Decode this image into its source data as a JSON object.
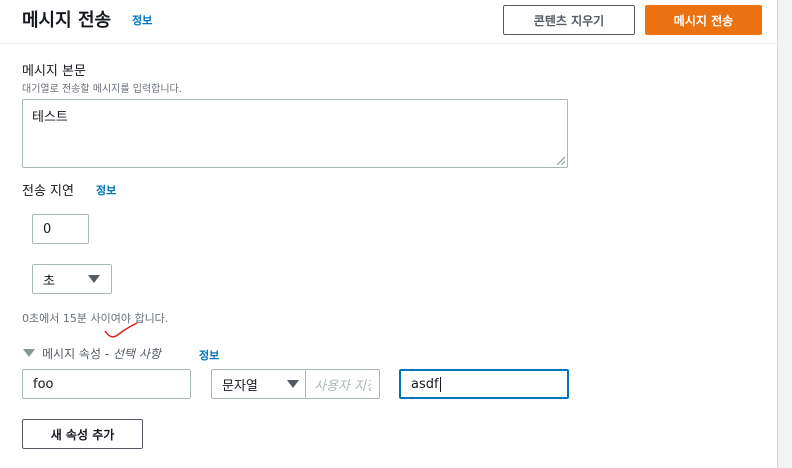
{
  "header": {
    "title": "메시지 전송",
    "info": "정보",
    "clear_button": "콘텐츠 지우기",
    "send_button": "메시지 전송"
  },
  "body_field": {
    "label": "메시지 본문",
    "description": "대기열로 전송할 메시지를 입력합니다.",
    "value": "테스트"
  },
  "delay": {
    "label": "전송 지연",
    "info": "정보",
    "value": "0",
    "unit": "초",
    "constraint": "0초에서 15분 사이여야 합니다."
  },
  "attributes": {
    "label": "메시지 속성 -",
    "optional": "선택 사항",
    "info": "정보",
    "name": "foo",
    "type": "문자열",
    "custom_type_placeholder": "사용자 지정",
    "value": "asdf",
    "add_button": "새 속성 추가"
  },
  "colors": {
    "primary": "#ec7211",
    "link": "#0073bb",
    "focus": "#0073bb",
    "annotation": "#e0201b"
  }
}
